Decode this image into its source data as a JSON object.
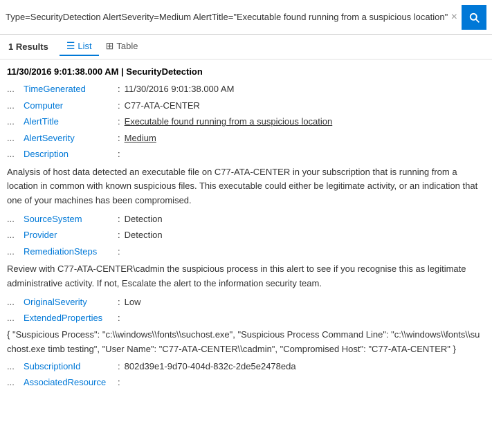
{
  "searchbar": {
    "query": "Type=SecurityDetection AlertSeverity=Medium AlertTitle=\"Executable found running from a suspicious loc...",
    "full_query": "Type=SecurityDetection AlertSeverity=Medium AlertTitle=\"Executable found running from a suspicious location\"",
    "clear_label": "×",
    "search_icon": "search"
  },
  "results": {
    "count": "1",
    "count_label": "Results"
  },
  "tabs": [
    {
      "id": "list",
      "label": "List",
      "icon": "☰",
      "active": true
    },
    {
      "id": "table",
      "label": "Table",
      "icon": "⊞",
      "active": false
    }
  ],
  "record": {
    "header": "11/30/2016 9:01:38.000 AM | SecurityDetection",
    "fields": [
      {
        "name": "TimeGenerated",
        "value": "11/30/2016 9:01:38.000 AM",
        "type": "plain"
      },
      {
        "name": "Computer",
        "value": "C77-ATA-CENTER",
        "type": "plain"
      },
      {
        "name": "AlertTitle",
        "value": "Executable found running from a suspicious location",
        "type": "underline"
      },
      {
        "name": "AlertSeverity",
        "value": "Medium",
        "type": "underline"
      },
      {
        "name": "Description",
        "value": "",
        "type": "plain"
      }
    ],
    "description": "Analysis of host data detected an executable file on C77-ATA-CENTER in your subscription that is running from a location in common with known suspicious files. This executable could either be legitimate activity, or an indication that one of your machines has been compromised.",
    "source_fields": [
      {
        "name": "SourceSystem",
        "value": "Detection",
        "type": "plain"
      },
      {
        "name": "Provider",
        "value": "Detection",
        "type": "plain"
      },
      {
        "name": "RemediationSteps",
        "value": "",
        "type": "plain"
      }
    ],
    "remediation": "Review with C77-ATA-CENTER\\cadmin the suspicious process in this alert to see if you recognise this as legitimate administrative activity. If not, Escalate the alert to the information security team.",
    "extra_fields": [
      {
        "name": "OriginalSeverity",
        "value": "Low",
        "type": "plain"
      },
      {
        "name": "ExtendedProperties",
        "value": "",
        "type": "plain"
      }
    ],
    "extended_block": "{ \"Suspicious Process\": \"c:\\\\windows\\\\fonts\\\\suchost.exe\", \"Suspicious Process Command Line\": \"c:\\\\windows\\\\fonts\\\\suchost.exe timb testing\", \"User Name\": \"C77-ATA-CENTER\\\\cadmin\", \"Compromised Host\": \"C77-ATA-CENTER\" }",
    "bottom_fields": [
      {
        "name": "SubscriptionId",
        "value": "802d39e1-9d70-404d-832c-2de5e2478eda",
        "type": "plain"
      },
      {
        "name": "AssociatedResource",
        "value": "",
        "type": "plain"
      }
    ]
  }
}
